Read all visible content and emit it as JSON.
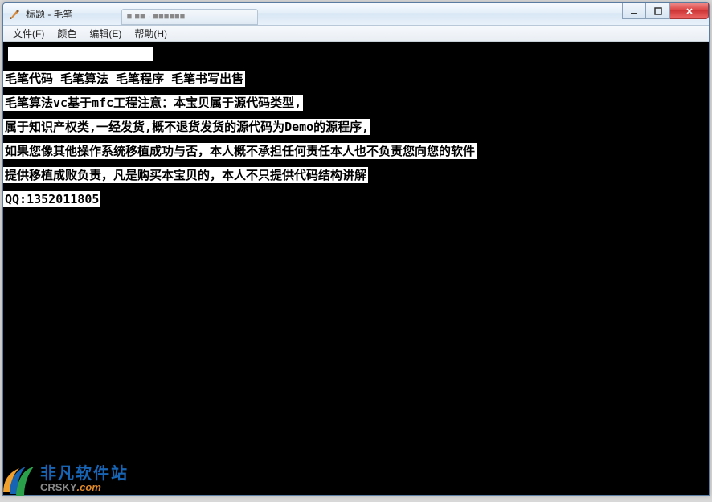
{
  "titlebar": {
    "title": "标题 - 毛笔",
    "background_tab": "■ ■■ · ■■■■■■"
  },
  "window_controls": {
    "minimize": "minimize",
    "maximize": "maximize",
    "close": "close"
  },
  "menubar": {
    "items": [
      {
        "label": "文件(F)"
      },
      {
        "label": "颜色"
      },
      {
        "label": "编辑(E)"
      },
      {
        "label": "帮助(H)"
      }
    ]
  },
  "content": {
    "lines": [
      "毛笔代码 毛笔算法 毛笔程序 毛笔书写出售",
      "毛笔算法vc基于mfc工程注意：本宝贝属于源代码类型,",
      "属于知识产权类,一经发货,概不退货发货的源代码为Demo的源程序,",
      "如果您像其他操作系统移植成功与否，本人概不承担任何责任本人也不负责您向您的软件",
      "提供移植成败负责，凡是购买本宝贝的，本人不只提供代码结构讲解",
      "QQ:1352011805"
    ]
  },
  "watermark": {
    "cn": "非凡软件站",
    "en_main": "CRSKY",
    "en_suffix": ".com"
  }
}
